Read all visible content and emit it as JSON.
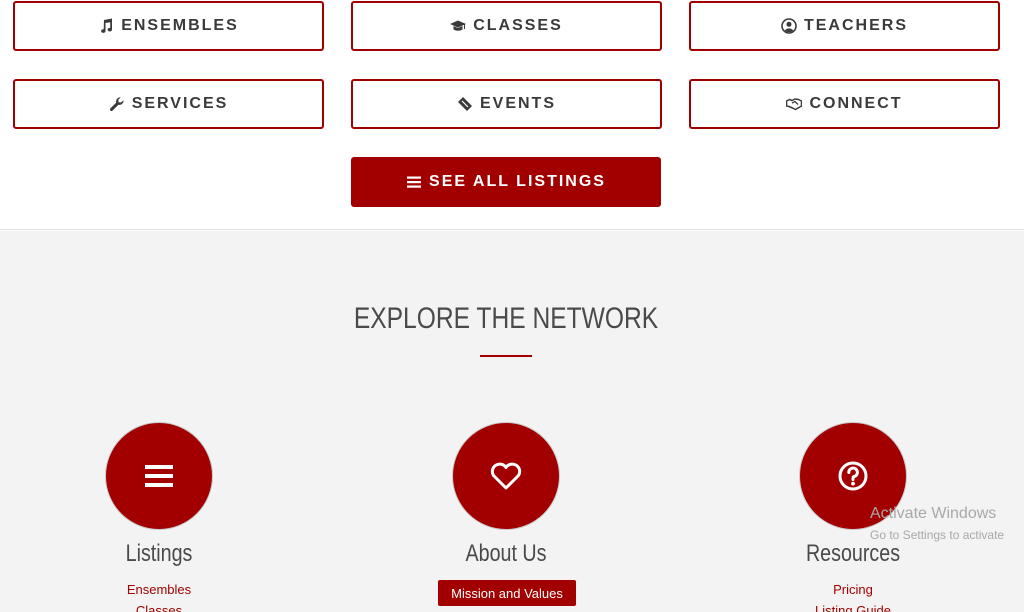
{
  "categories": [
    {
      "label": "ENSEMBLES",
      "icon": "music-note-icon"
    },
    {
      "label": "CLASSES",
      "icon": "graduation-cap-icon"
    },
    {
      "label": "TEACHERS",
      "icon": "user-circle-icon"
    },
    {
      "label": "SERVICES",
      "icon": "wrench-icon"
    },
    {
      "label": "EVENTS",
      "icon": "ticket-icon"
    },
    {
      "label": "CONNECT",
      "icon": "handshake-icon"
    }
  ],
  "see_all": {
    "label": "SEE ALL LISTINGS",
    "icon": "bars-icon"
  },
  "explore": {
    "title": "EXPLORE THE NETWORK",
    "columns": [
      {
        "title": "Listings",
        "icon": "bars-icon",
        "links": [
          "Ensembles",
          "Classes"
        ]
      },
      {
        "title": "About Us",
        "icon": "heart-icon",
        "button": "Mission and Values"
      },
      {
        "title": "Resources",
        "icon": "question-circle-icon",
        "links": [
          "Pricing",
          "Listing Guide"
        ]
      }
    ]
  },
  "watermark": {
    "line1": "Activate Windows",
    "line2": "Go to Settings to activate"
  },
  "colors": {
    "accent": "#a20000",
    "section_bg": "#f3f3f3",
    "text": "#3a3a3a"
  }
}
